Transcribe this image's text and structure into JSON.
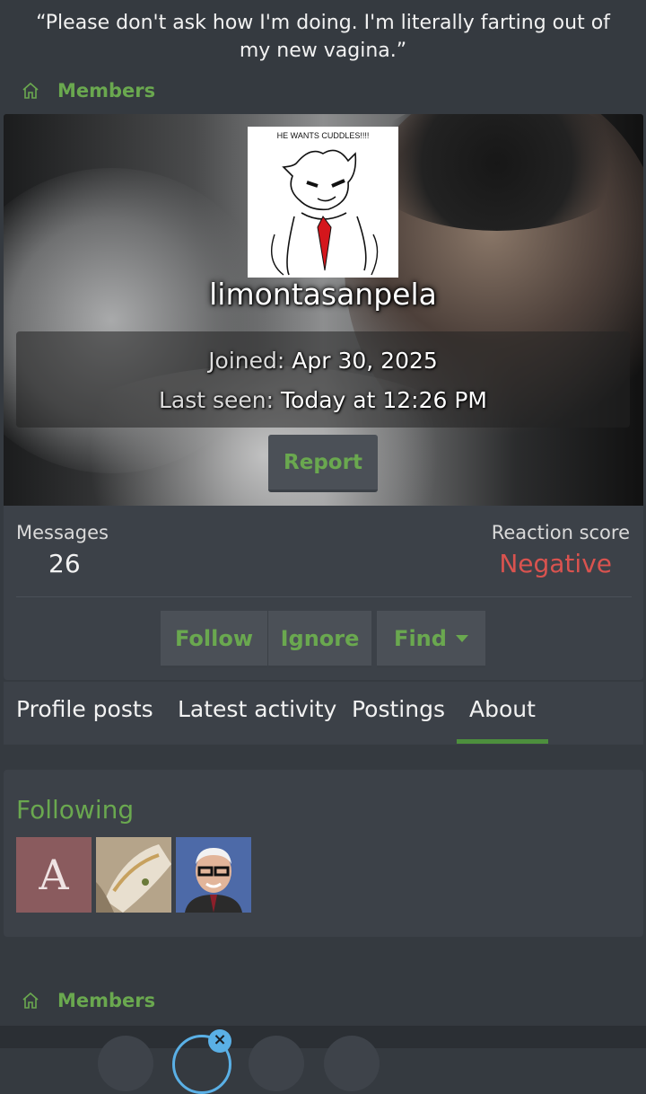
{
  "quote": "“Please don't ask how I'm doing. I'm literally farting out of my new vagina.”",
  "breadcrumb": {
    "label": "Members"
  },
  "profile": {
    "avatar_caption": "HE WANTS CUDDLES!!!!",
    "username": "limontasanpela",
    "joined_label": "Joined:",
    "joined_value": "Apr 30, 2025",
    "last_seen_label": "Last seen:",
    "last_seen_value": "Today at 12:26 PM",
    "report_label": "Report"
  },
  "stats": {
    "messages_label": "Messages",
    "messages_value": "26",
    "reaction_label": "Reaction score",
    "reaction_value": "Negative"
  },
  "actions": {
    "follow": "Follow",
    "ignore": "Ignore",
    "find": "Find"
  },
  "tabs": [
    "Profile posts",
    "Latest activity",
    "Postings",
    "About"
  ],
  "active_tab": "About",
  "following": {
    "title": "Following",
    "first_letter": "A"
  },
  "colors": {
    "accent": "#6aa84f",
    "negative": "#d9534f",
    "background": "#353a40",
    "panel": "#3c4148"
  }
}
